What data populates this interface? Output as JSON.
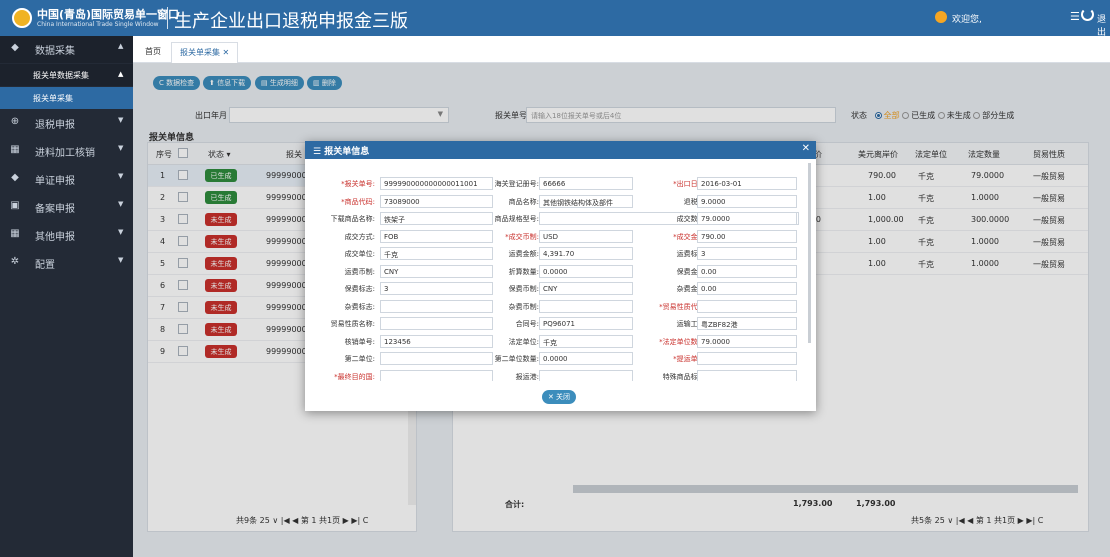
{
  "header": {
    "brand_cn": "中国(青岛)国际贸易单一窗口",
    "brand_en": "China International Trade Single Window",
    "title": "生产企业出口退税申报金三版",
    "welcome": "欢迎您,",
    "menu_icon": "☰",
    "logout": "退出"
  },
  "sidebar": {
    "top": {
      "label": "数据采集",
      "arrow": "▲"
    },
    "sub": {
      "label": "报关单数据采集",
      "arrow": "▲"
    },
    "subsub": {
      "label": "报关单采集"
    },
    "items": [
      {
        "label": "退税申报",
        "icon": "⊕"
      },
      {
        "label": "进料加工核销",
        "icon": "▦"
      },
      {
        "label": "单证申报",
        "icon": "◆"
      },
      {
        "label": "备案申报",
        "icon": "▣"
      },
      {
        "label": "其他申报",
        "icon": "▦"
      },
      {
        "label": "配置",
        "icon": "✲"
      }
    ]
  },
  "tabs": [
    {
      "label": "首页"
    },
    {
      "label": "报关单采集 ✕"
    }
  ],
  "toolbar": {
    "b1": "C 数据检查",
    "b2": "⬆ 信息下载",
    "b3": "▤ 生成明细",
    "b4": "▥ 删除"
  },
  "filters": {
    "month_label": "出口年月",
    "decl_label": "报关单号",
    "decl_placeholder": "请输入18位报关单号或后4位",
    "status_label": "状态",
    "opt_all": "全部",
    "opt_gen": "已生成",
    "opt_nogen": "未生成",
    "opt_part": "部分生成"
  },
  "section_title": "报关单信息",
  "left_table": {
    "headers": {
      "seq": "序号",
      "status": "状态 ▾",
      "num": "报关"
    },
    "rows": [
      {
        "seq": "1",
        "status": "已生成",
        "num": "9999900000"
      },
      {
        "seq": "2",
        "status": "已生成",
        "num": "9999900000"
      },
      {
        "seq": "3",
        "status": "未生成",
        "num": "9999900000"
      },
      {
        "seq": "4",
        "status": "未生成",
        "num": "9999900000"
      },
      {
        "seq": "5",
        "status": "未生成",
        "num": "9999900000"
      },
      {
        "seq": "6",
        "status": "未生成",
        "num": "9999900000"
      },
      {
        "seq": "7",
        "status": "未生成",
        "num": "9999900000"
      },
      {
        "seq": "8",
        "status": "未生成",
        "num": "9999900000"
      },
      {
        "seq": "9",
        "status": "未生成",
        "num": "9999900000"
      }
    ],
    "pager": "共9条  25  ∨   |◀  ◀  第 1  共1页  ▶  ▶|  C"
  },
  "right_table": {
    "headers": {
      "c1": "离岸价",
      "c2": "美元离岸价",
      "c3": "法定单位",
      "c4": "法定数量",
      "c5": "贸易性质"
    },
    "rows": [
      {
        "c1": ".00",
        "c2": "790.00",
        "c3": "千克",
        "c4": "79.0000",
        "c5": "一般贸易"
      },
      {
        "c1": ".00",
        "c2": "1.00",
        "c3": "千克",
        "c4": "1.0000",
        "c5": "一般贸易"
      },
      {
        "c1": "00.00",
        "c2": "1,000.00",
        "c3": "千克",
        "c4": "300.0000",
        "c5": "一般贸易"
      },
      {
        "c1": ".00",
        "c2": "1.00",
        "c3": "千克",
        "c4": "1.0000",
        "c5": "一般贸易"
      },
      {
        "c1": ".00",
        "c2": "1.00",
        "c3": "千克",
        "c4": "1.0000",
        "c5": "一般贸易"
      }
    ],
    "sum_label": "合计:",
    "sum1": "1,793.00",
    "sum2": "1,793.00",
    "pager": "共5条  25  ∨   |◀  ◀  第 1  共1页  ▶  ▶|  C"
  },
  "dialog": {
    "title": "☰ 报关单信息",
    "close": "✕",
    "close_btn": "✕ 关闭",
    "fields": [
      {
        "label": "*报关单号:",
        "value": "999990000000000011001",
        "req": true
      },
      {
        "label": "海关登记册号:",
        "value": "66666",
        "req": false
      },
      {
        "label": "*出口日期:",
        "value": "2016-03-01",
        "req": true
      },
      {
        "label": "*商品代码:",
        "value": "73089000",
        "req": true
      },
      {
        "label": "商品名称:",
        "value": "其他钢铁结构体及部件",
        "req": false
      },
      {
        "label": "退税率:",
        "value": "9.0000",
        "req": false
      },
      {
        "label": "下载商品名称:",
        "value": "铁架子",
        "req": false
      },
      {
        "label": "商品规格型号:",
        "value": "",
        "req": false
      },
      {
        "label": "成交数量:",
        "value": "79.0000",
        "req": false
      },
      {
        "label": "成交方式:",
        "value": "FOB",
        "req": false
      },
      {
        "label": "*成交币制:",
        "value": "USD",
        "req": true
      },
      {
        "label": "*成交金额:",
        "value": "790.00",
        "req": true
      },
      {
        "label": "成交单位:",
        "value": "千克",
        "req": false
      },
      {
        "label": "运费金额:",
        "value": "4,391.70",
        "req": false
      },
      {
        "label": "运费标志:",
        "value": "3",
        "req": false
      },
      {
        "label": "运费币制:",
        "value": "CNY",
        "req": false
      },
      {
        "label": "折算数量:",
        "value": "0.0000",
        "req": false
      },
      {
        "label": "保费金额:",
        "value": "0.00",
        "req": false
      },
      {
        "label": "保费标志:",
        "value": "3",
        "req": false
      },
      {
        "label": "保费币制:",
        "value": "CNY",
        "req": false
      },
      {
        "label": "杂费金额:",
        "value": "0.00",
        "req": false
      },
      {
        "label": "杂费标志:",
        "value": "",
        "req": false
      },
      {
        "label": "杂费币制:",
        "value": "",
        "req": false
      },
      {
        "label": "*贸易性质代码:",
        "value": "",
        "req": true
      },
      {
        "label": "贸易性质名称:",
        "value": "",
        "req": false
      },
      {
        "label": "合同号:",
        "value": "PQ96071",
        "req": false
      },
      {
        "label": "运输工具:",
        "value": "粤ZBF82港",
        "req": false
      },
      {
        "label": "核销单号:",
        "value": "123456",
        "req": false
      },
      {
        "label": "法定单位:",
        "value": "千克",
        "req": false
      },
      {
        "label": "*法定单位数量:",
        "value": "79.0000",
        "req": true
      },
      {
        "label": "第二单位:",
        "value": "",
        "req": false
      },
      {
        "label": "第二单位数量:",
        "value": "0.0000",
        "req": false
      },
      {
        "label": "*提运单号:",
        "value": "",
        "req": true
      },
      {
        "label": "*最终目的国:",
        "value": "",
        "req": true
      },
      {
        "label": "报运港:",
        "value": "",
        "req": false
      },
      {
        "label": "特殊商品标识:",
        "value": "",
        "req": false
      }
    ]
  }
}
